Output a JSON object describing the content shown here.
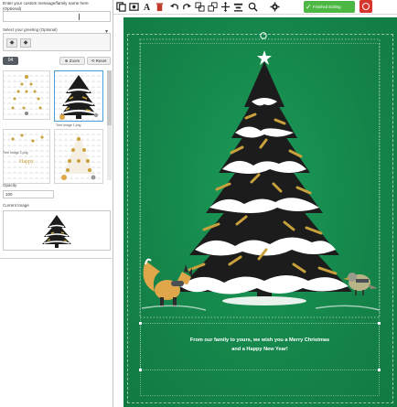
{
  "sidebar": {
    "prompt": "Enter your custom message/family name here (Optional)",
    "greeting_label": "Select your greeting (Optional)",
    "badge": "04",
    "zoom_label": "Zoom",
    "reset_label": "Reset",
    "captions": {
      "thumb2": "Tree Image 1.png",
      "thumb3": "Tree Image 2.png"
    },
    "opacity_label": "Opacity",
    "opacity_value": "100",
    "current_image_label": "Current Image"
  },
  "toolbar": {
    "finish_label": "Finished Editing"
  },
  "card": {
    "greeting_line1": "From our family to yours, we wish you a Merry Christmas",
    "greeting_line2": "and a Happy New Year!",
    "colors": {
      "background": "#15824a",
      "tree": "#1c1c1c",
      "snow": "#ffffff",
      "gold": "#c9a13c",
      "fox": "#e0a64a"
    }
  }
}
